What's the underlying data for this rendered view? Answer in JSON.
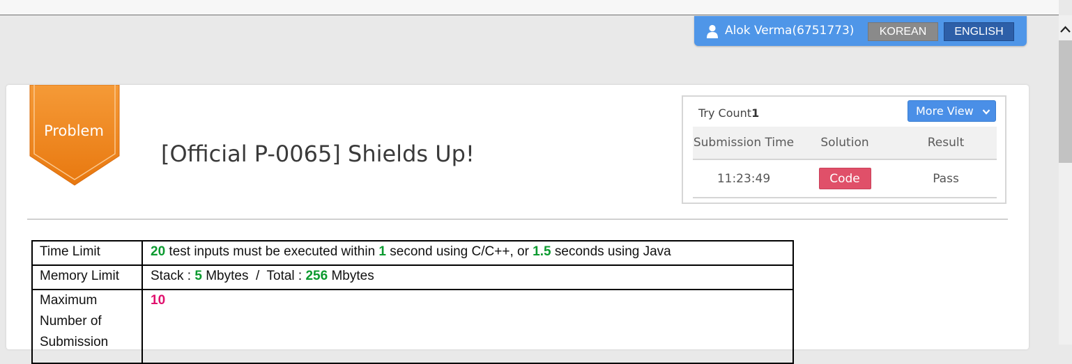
{
  "user_bar": {
    "user_label": "Alok Verma(6751773)",
    "korean_label": "KOREAN",
    "english_label": "ENGLISH"
  },
  "badge": {
    "label": "Problem"
  },
  "problem": {
    "title": "[Official P-0065] Shields Up!"
  },
  "submission_box": {
    "try_label": "Try Count",
    "try_count": "1",
    "more_view_label": "More View",
    "headers": {
      "time": "Submission Time",
      "solution": "Solution",
      "result": "Result"
    },
    "rows": [
      {
        "time": "11:23:49",
        "solution": "Code",
        "result": "Pass"
      }
    ]
  },
  "limits": {
    "time_limit": {
      "label": "Time Limit",
      "tests": "20",
      "text_a": " test inputs must be executed within ",
      "cpp_seconds": "1",
      "text_b": " second using C/C++, or ",
      "java_seconds": "1.5",
      "text_c": " seconds using Java"
    },
    "memory_limit": {
      "label": "Memory Limit",
      "stack_prefix": "Stack : ",
      "stack_value": "5",
      "stack_unit": " Mbytes  /  Total : ",
      "total_value": "256",
      "total_unit": " Mbytes"
    },
    "max_submission": {
      "label": "Maximum Number of Submission",
      "value": "10"
    }
  },
  "colors": {
    "accent_blue": "#4f96e8",
    "badge_orange": "#f08a24",
    "code_red": "#e05069",
    "highlight_green": "#0b9a2f",
    "highlight_magenta": "#e0106d"
  },
  "icons": [
    "user-icon",
    "chevron-down-icon",
    "scroll-up-arrow-icon"
  ]
}
